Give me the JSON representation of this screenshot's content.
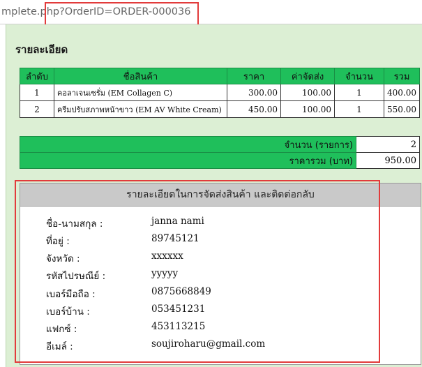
{
  "browser": {
    "url_text": "mplete.php?OrderID=ORDER-000036"
  },
  "page": {
    "heading": "รายละเอียด"
  },
  "items_table": {
    "headers": [
      "ลำดับ",
      "ชื่อสินค้า",
      "ราคา",
      "ค่าจัดส่ง",
      "จำนวน",
      "รวม"
    ],
    "rows": [
      {
        "no": "1",
        "name": "คอลาเจนเซรั่ม (EM Collagen C)",
        "price": "300.00",
        "shipping": "100.00",
        "qty": "1",
        "total": "400.00"
      },
      {
        "no": "2",
        "name": "ครีมปรับสภาพหน้าขาว (EM AV White Cream)",
        "price": "450.00",
        "shipping": "100.00",
        "qty": "1",
        "total": "550.00"
      }
    ]
  },
  "summary": {
    "count_label": "จำนวน (รายการ)",
    "count_value": "2",
    "total_label": "ราคารวม (บาท)",
    "total_value": "950.00"
  },
  "shipping": {
    "title": "รายละเอียดในการจัดส่งสินค้า และติดต่อกลับ",
    "fields": [
      {
        "label": "ชื่อ-นามสกุล :",
        "value": "janna nami"
      },
      {
        "label": "ที่อยู่ :",
        "value": "89745121"
      },
      {
        "label": "จังหวัด :",
        "value": "xxxxxx"
      },
      {
        "label": "รหัสไปรษณีย์ :",
        "value": "yyyyy"
      },
      {
        "label": "เบอร์มือถือ :",
        "value": "0875668849"
      },
      {
        "label": "เบอร์บ้าน :",
        "value": "053451231"
      },
      {
        "label": "แฟกซ์ :",
        "value": "453113215"
      },
      {
        "label": "อีเมล์ :",
        "value": "soujiroharu@gmail.com"
      }
    ]
  },
  "colors": {
    "header_green": "#1fbf5b",
    "panel_green": "#dcefd4",
    "highlight_red": "#e23b3b"
  }
}
